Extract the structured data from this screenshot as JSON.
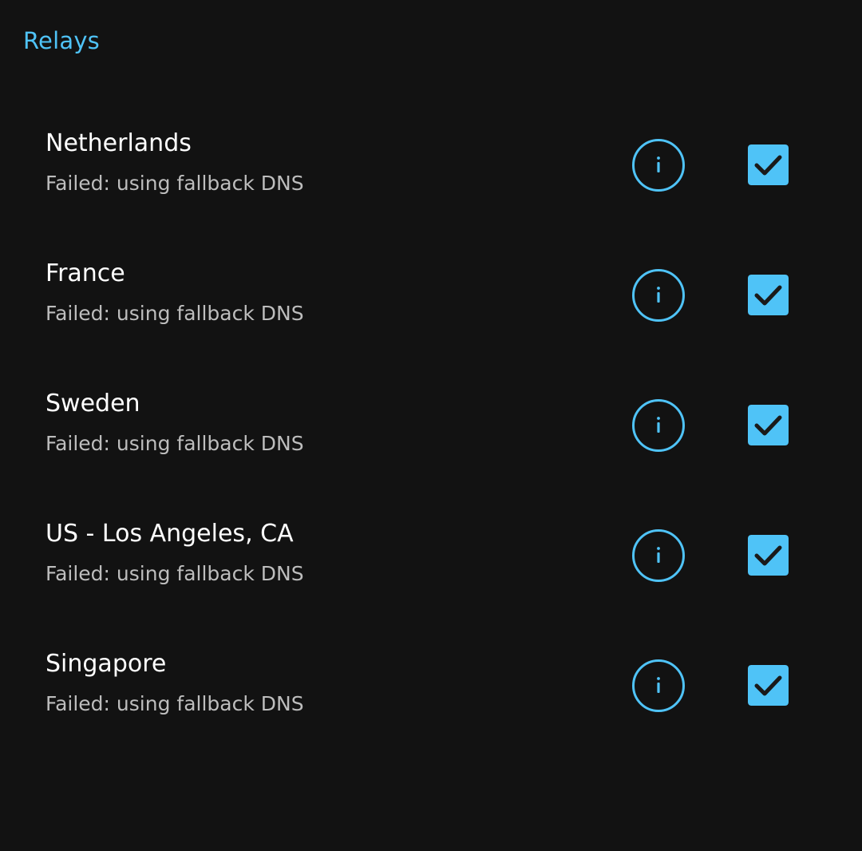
{
  "header": {
    "title": "Relays"
  },
  "colors": {
    "accent": "#4fc3f7",
    "background": "#121212",
    "primary_text": "#ffffff",
    "secondary_text": "#bdbdbd",
    "check_mark": "#1a1a1a"
  },
  "relays": [
    {
      "name": "Netherlands",
      "status": "Failed: using fallback DNS",
      "checked": true,
      "info_icon": "info-icon",
      "check_icon": "checkbox-checked-icon"
    },
    {
      "name": "France",
      "status": "Failed: using fallback DNS",
      "checked": true,
      "info_icon": "info-icon",
      "check_icon": "checkbox-checked-icon"
    },
    {
      "name": "Sweden",
      "status": "Failed: using fallback DNS",
      "checked": true,
      "info_icon": "info-icon",
      "check_icon": "checkbox-checked-icon"
    },
    {
      "name": "US - Los Angeles, CA",
      "status": "Failed: using fallback DNS",
      "checked": true,
      "info_icon": "info-icon",
      "check_icon": "checkbox-checked-icon"
    },
    {
      "name": "Singapore",
      "status": "Failed: using fallback DNS",
      "checked": true,
      "info_icon": "info-icon",
      "check_icon": "checkbox-checked-icon"
    }
  ]
}
